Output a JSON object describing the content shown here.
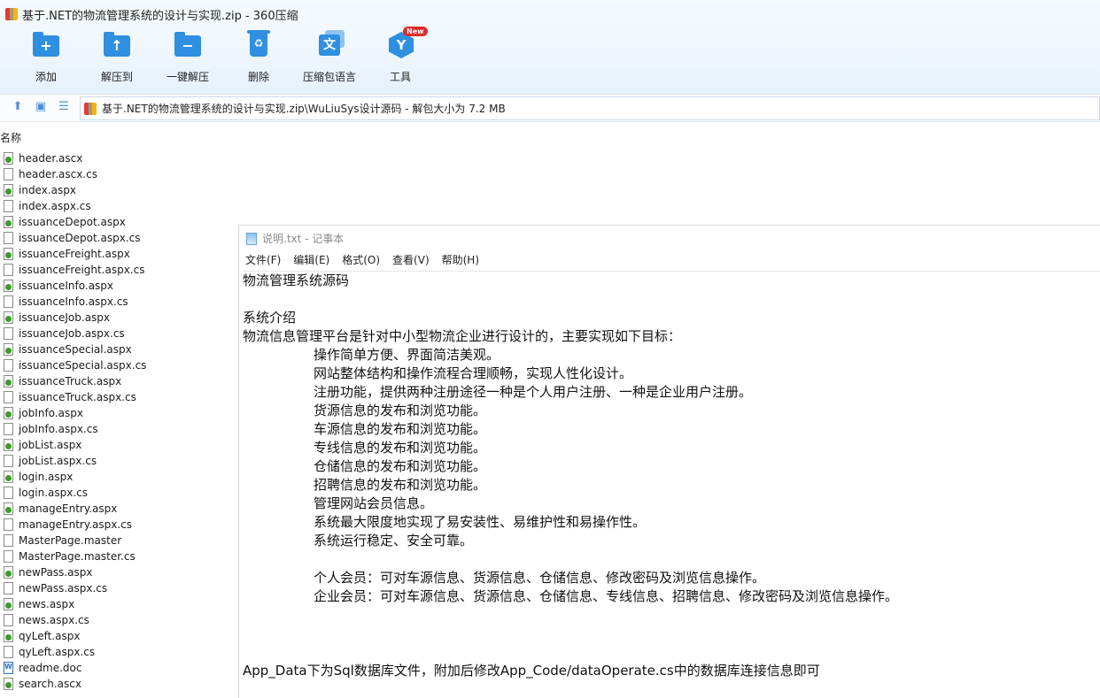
{
  "window": {
    "title": "基于.NET的物流管理系统的设计与实现.zip - 360压缩"
  },
  "toolbar": {
    "items": [
      {
        "label": "添加",
        "icon": "add-folder-icon"
      },
      {
        "label": "解压到",
        "icon": "extract-to-icon"
      },
      {
        "label": "一键解压",
        "icon": "one-click-extract-icon"
      },
      {
        "label": "删除",
        "icon": "delete-icon"
      },
      {
        "label": "压缩包语言",
        "icon": "archive-language-icon"
      },
      {
        "label": "工具",
        "icon": "tools-icon",
        "badge": "New"
      }
    ]
  },
  "addressbar": {
    "path": "基于.NET的物流管理系统的设计与实现.zip\\WuLiuSys设计源码 - 解包大小为 7.2 MB"
  },
  "filelist": {
    "header": "名称",
    "files": [
      {
        "name": "header.ascx",
        "type": "aspx"
      },
      {
        "name": "header.ascx.cs",
        "type": "cs"
      },
      {
        "name": "index.aspx",
        "type": "aspx"
      },
      {
        "name": "index.aspx.cs",
        "type": "cs"
      },
      {
        "name": "issuanceDepot.aspx",
        "type": "aspx"
      },
      {
        "name": "issuanceDepot.aspx.cs",
        "type": "cs"
      },
      {
        "name": "issuanceFreight.aspx",
        "type": "aspx"
      },
      {
        "name": "issuanceFreight.aspx.cs",
        "type": "cs"
      },
      {
        "name": "issuanceInfo.aspx",
        "type": "aspx"
      },
      {
        "name": "issuanceInfo.aspx.cs",
        "type": "cs"
      },
      {
        "name": "issuanceJob.aspx",
        "type": "aspx"
      },
      {
        "name": "issuanceJob.aspx.cs",
        "type": "cs"
      },
      {
        "name": "issuanceSpecial.aspx",
        "type": "aspx"
      },
      {
        "name": "issuanceSpecial.aspx.cs",
        "type": "cs"
      },
      {
        "name": "issuanceTruck.aspx",
        "type": "aspx"
      },
      {
        "name": "issuanceTruck.aspx.cs",
        "type": "cs"
      },
      {
        "name": "jobInfo.aspx",
        "type": "aspx"
      },
      {
        "name": "jobInfo.aspx.cs",
        "type": "cs"
      },
      {
        "name": "jobList.aspx",
        "type": "aspx"
      },
      {
        "name": "jobList.aspx.cs",
        "type": "cs"
      },
      {
        "name": "login.aspx",
        "type": "aspx"
      },
      {
        "name": "login.aspx.cs",
        "type": "cs"
      },
      {
        "name": "manageEntry.aspx",
        "type": "aspx"
      },
      {
        "name": "manageEntry.aspx.cs",
        "type": "cs"
      },
      {
        "name": "MasterPage.master",
        "type": "cs"
      },
      {
        "name": "MasterPage.master.cs",
        "type": "cs"
      },
      {
        "name": "newPass.aspx",
        "type": "aspx"
      },
      {
        "name": "newPass.aspx.cs",
        "type": "cs"
      },
      {
        "name": "news.aspx",
        "type": "aspx"
      },
      {
        "name": "news.aspx.cs",
        "type": "cs"
      },
      {
        "name": "qyLeft.aspx",
        "type": "aspx"
      },
      {
        "name": "qyLeft.aspx.cs",
        "type": "cs"
      },
      {
        "name": "readme.doc",
        "type": "doc"
      },
      {
        "name": "search.ascx",
        "type": "aspx"
      }
    ]
  },
  "notepad": {
    "title": "说明.txt - 记事本",
    "menu": [
      "文件(F)",
      "编辑(E)",
      "格式(O)",
      "查看(V)",
      "帮助(H)"
    ],
    "lines": [
      {
        "text": "物流管理系统源码",
        "indent": false
      },
      {
        "text": "",
        "indent": false
      },
      {
        "text": "系统介绍",
        "indent": false
      },
      {
        "text": "物流信息管理平台是针对中小型物流企业进行设计的，主要实现如下目标：",
        "indent": false
      },
      {
        "text": "操作简单方便、界面简洁美观。",
        "indent": true
      },
      {
        "text": "网站整体结构和操作流程合理顺畅，实现人性化设计。",
        "indent": true
      },
      {
        "text": "注册功能，提供两种注册途径一种是个人用户注册、一种是企业用户注册。",
        "indent": true
      },
      {
        "text": "货源信息的发布和浏览功能。",
        "indent": true
      },
      {
        "text": "车源信息的发布和浏览功能。",
        "indent": true
      },
      {
        "text": "专线信息的发布和浏览功能。",
        "indent": true
      },
      {
        "text": "仓储信息的发布和浏览功能。",
        "indent": true
      },
      {
        "text": "招聘信息的发布和浏览功能。",
        "indent": true
      },
      {
        "text": "管理网站会员信息。",
        "indent": true
      },
      {
        "text": "系统最大限度地实现了易安装性、易维护性和易操作性。",
        "indent": true
      },
      {
        "text": "系统运行稳定、安全可靠。",
        "indent": true
      },
      {
        "text": "",
        "indent": false
      },
      {
        "text": "个人会员：可对车源信息、货源信息、仓储信息、修改密码及浏览信息操作。",
        "indent": true
      },
      {
        "text": "企业会员：可对车源信息、货源信息、仓储信息、专线信息、招聘信息、修改密码及浏览信息操作。",
        "indent": true
      },
      {
        "text": "",
        "indent": false
      },
      {
        "text": "",
        "indent": false
      },
      {
        "text": "",
        "indent": false
      },
      {
        "text": "App_Data下为Sql数据库文件，附加后修改App_Code/dataOperate.cs中的数据库连接信息即可",
        "indent": false
      }
    ]
  }
}
